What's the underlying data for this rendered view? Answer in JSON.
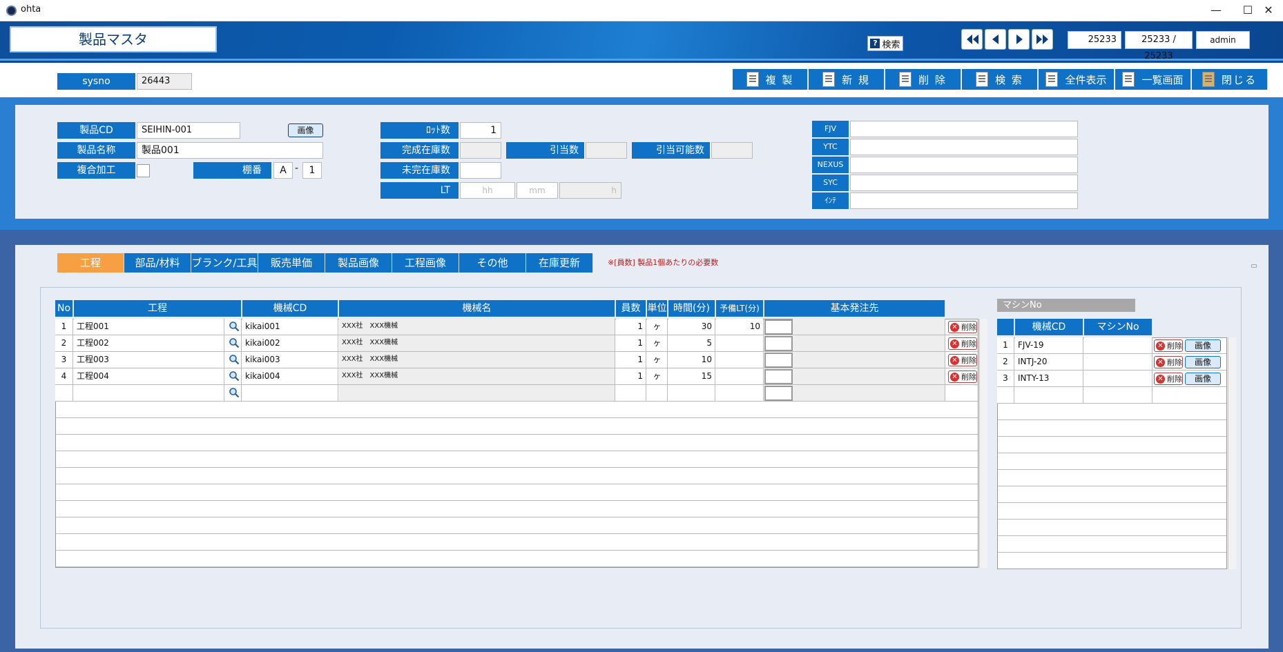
{
  "window": {
    "title": "ohta"
  },
  "header": {
    "page_title": "製品マスタ",
    "search_help": "検索",
    "record_current": "25233",
    "record_position": "25233 / 25233",
    "user": "admin"
  },
  "record": {
    "sysno_label": "sysno",
    "sysno_value": "26443"
  },
  "toolbar": {
    "copy": "複 製",
    "new": "新 規",
    "delete": "削 除",
    "search": "検 索",
    "show_all": "全件表示",
    "list_view": "一覧画面",
    "close": "閉じる"
  },
  "product": {
    "code_label": "製品CD",
    "code_value": "SEIHIN-001",
    "image_button": "画像",
    "name_label": "製品名称",
    "name_value": "製品001",
    "composite_label": "複合加工",
    "shelf_label": "棚番",
    "shelf_a": "A",
    "shelf_dash": "-",
    "shelf_b": "1",
    "lot_label": "ﾛｯﾄ数",
    "lot_value": "1",
    "finished_stock_label": "完成在庫数",
    "allocated_label": "引当数",
    "allocatable_label": "引当可能数",
    "unfinished_stock_label": "未完在庫数",
    "lt_label": "LT",
    "lt_hh": "hh",
    "lt_mm": "mm",
    "lt_h": "h",
    "customers": [
      "FJV",
      "YTC",
      "NEXUS",
      "SYC",
      "ｲﾝﾃ"
    ]
  },
  "tabs": [
    "工程",
    "部品/材料",
    "ブランク/工具",
    "販売単価",
    "製品画像",
    "工程画像",
    "その他",
    "在庫更新"
  ],
  "note": "※[員数] 製品1個あたりの必要数",
  "process_grid": {
    "headers": [
      "No",
      "工程",
      "機械CD",
      "機械名",
      "員数",
      "単位",
      "時間(分)",
      "予備LT(分)",
      "基本発注先"
    ],
    "rows": [
      {
        "no": "1",
        "process": "工程001",
        "machine_cd": "kikai001",
        "machine_name": "XXX社　XXX機械",
        "qty": "1",
        "unit": "ヶ",
        "time": "30",
        "spare": "10"
      },
      {
        "no": "2",
        "process": "工程002",
        "machine_cd": "kikai002",
        "machine_name": "XXX社　XXX機械",
        "qty": "1",
        "unit": "ヶ",
        "time": "5",
        "spare": ""
      },
      {
        "no": "3",
        "process": "工程003",
        "machine_cd": "kikai003",
        "machine_name": "XXX社　XXX機械",
        "qty": "1",
        "unit": "ヶ",
        "time": "10",
        "spare": ""
      },
      {
        "no": "4",
        "process": "工程004",
        "machine_cd": "kikai004",
        "machine_name": "XXX社　XXX機械",
        "qty": "1",
        "unit": "ヶ",
        "time": "15",
        "spare": ""
      }
    ],
    "delete_label": "削除"
  },
  "machine_panel": {
    "title": "マシンNo",
    "headers": [
      "機械CD",
      "マシンNo"
    ],
    "rows": [
      {
        "no": "1",
        "machine_cd": "FJV-19"
      },
      {
        "no": "2",
        "machine_cd": "INTJ-20"
      },
      {
        "no": "3",
        "machine_cd": "INTY-13"
      }
    ],
    "delete_label": "削除",
    "image_label": "画像"
  },
  "colors": {
    "primary": "#0f72c7",
    "active_tab": "#f6a043",
    "band": "#2a7fd2",
    "dark_band": "#3a64a6"
  }
}
